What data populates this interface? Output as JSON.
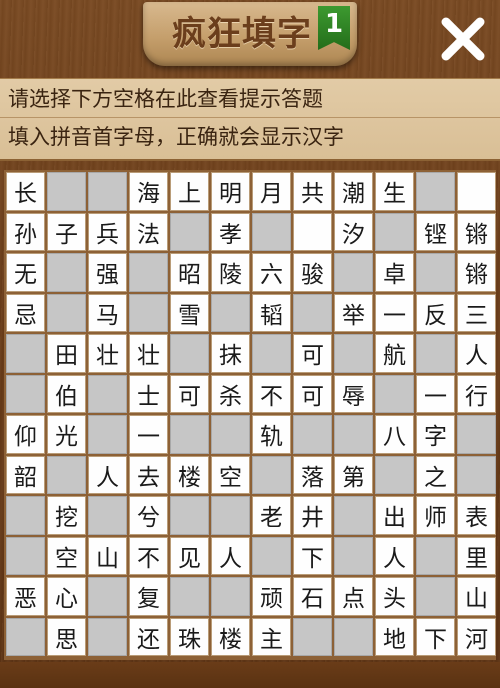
{
  "header": {
    "title": "疯狂填字",
    "level": "1",
    "close_icon": "close-x-icon"
  },
  "hints": {
    "line1": "请选择下方空格在此查看提示答题",
    "line2": "填入拼音首字母，正确就会显示汉字"
  },
  "grid": [
    [
      "长",
      "#",
      "#",
      "海",
      "上",
      "明",
      "月",
      "共",
      "潮",
      "生",
      "#",
      ""
    ],
    [
      "孙",
      "子",
      "兵",
      "法",
      "#",
      "孝",
      "#",
      "",
      "汐",
      "#",
      "铿",
      "锵"
    ],
    [
      "无",
      "#",
      "强",
      "#",
      "昭",
      "陵",
      "六",
      "骏",
      "#",
      "卓",
      "#",
      "锵"
    ],
    [
      "忌",
      "#",
      "马",
      "#",
      "雪",
      "#",
      "韬",
      "#",
      "举",
      "一",
      "反",
      "三"
    ],
    [
      "#",
      "田",
      "壮",
      "壮",
      "#",
      "抹",
      "#",
      "可",
      "#",
      "航",
      "#",
      "人"
    ],
    [
      "#",
      "伯",
      "#",
      "士",
      "可",
      "杀",
      "不",
      "可",
      "辱",
      "#",
      "一",
      "行"
    ],
    [
      "仰",
      "光",
      "#",
      "一",
      "#",
      "#",
      "轨",
      "#",
      "#",
      "八",
      "字",
      "#"
    ],
    [
      "韶",
      "#",
      "人",
      "去",
      "楼",
      "空",
      "#",
      "落",
      "第",
      "#",
      "之",
      "#"
    ],
    [
      "#",
      "挖",
      "#",
      "兮",
      "#",
      "#",
      "老",
      "井",
      "#",
      "出",
      "师",
      "表"
    ],
    [
      "#",
      "空",
      "山",
      "不",
      "见",
      "人",
      "#",
      "下",
      "#",
      "人",
      "#",
      "里"
    ],
    [
      "恶",
      "心",
      "#",
      "复",
      "#",
      "#",
      "顽",
      "石",
      "点",
      "头",
      "#",
      "山"
    ],
    [
      "#",
      "思",
      "#",
      "还",
      "珠",
      "楼",
      "主",
      "#",
      "#",
      "地",
      "下",
      "河"
    ]
  ]
}
